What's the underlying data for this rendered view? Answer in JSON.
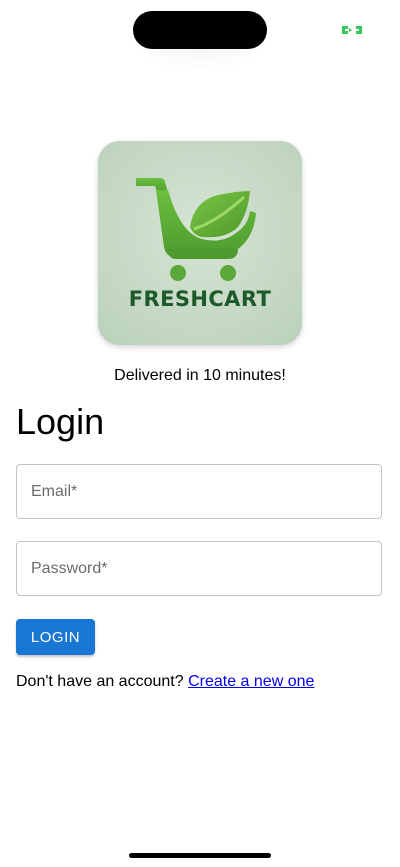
{
  "brand": {
    "name_part1": "FRESH",
    "name_part2": "CART",
    "colors": {
      "logo_background": "#c4d8c4",
      "cart_green": "#5aa83a",
      "leaf_green": "#6cb33a",
      "text_dark_green": "#1d5a2a"
    }
  },
  "tagline": "Delivered in 10 minutes!",
  "page_title": "Login",
  "form": {
    "email": {
      "placeholder": "Email*",
      "value": ""
    },
    "password": {
      "placeholder": "Password*",
      "value": ""
    },
    "submit_label": "LOGIN"
  },
  "signup": {
    "prompt": "Don't have an account?",
    "link_text": "Create a new one"
  },
  "colors": {
    "primary": "#1976d2",
    "link": "#0000ee",
    "status_indicator": "#34c759"
  },
  "icons": {
    "status": "screen-sharing-indicator-icon"
  }
}
